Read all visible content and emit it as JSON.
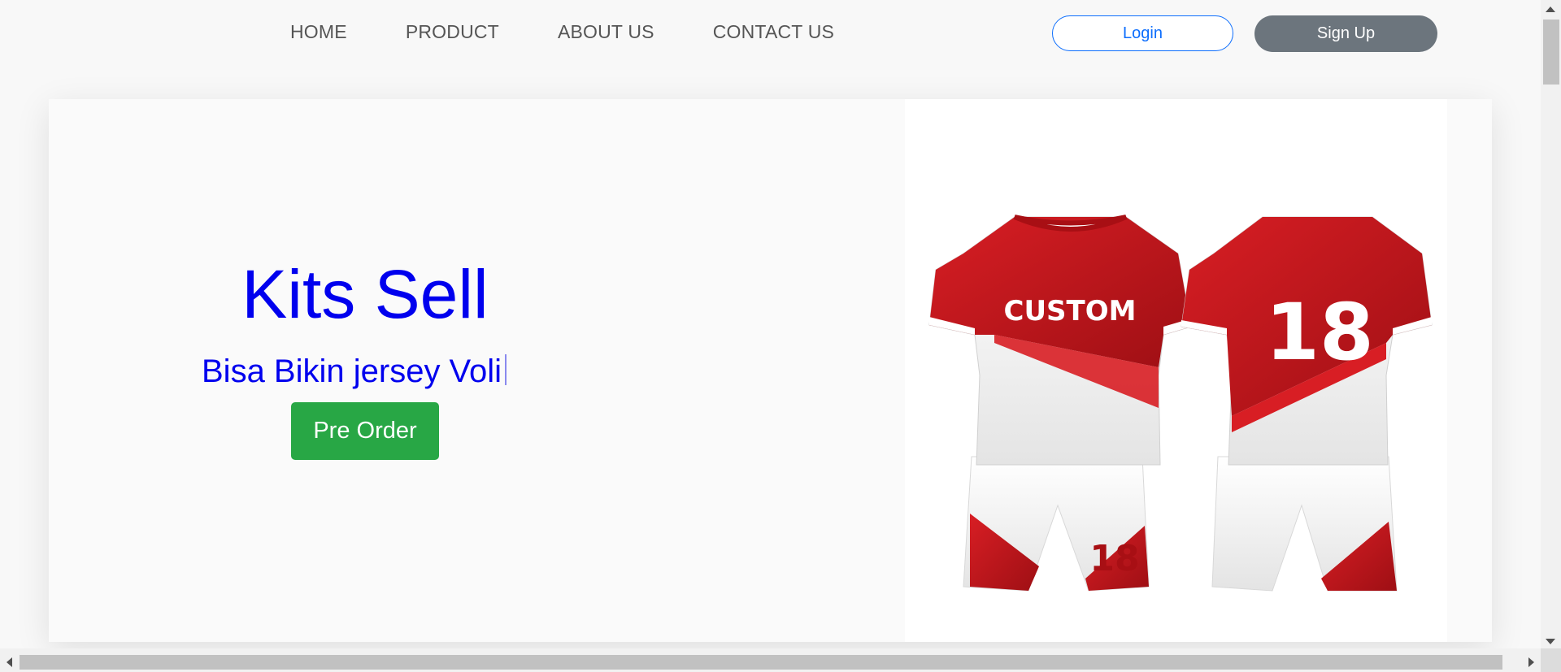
{
  "nav": {
    "links": [
      "HOME",
      "PRODUCT",
      "ABOUT US",
      "CONTACT US"
    ],
    "login_label": "Login",
    "signup_label": "Sign Up"
  },
  "hero": {
    "title": "Kits Sell",
    "subtitle": "Bisa Bikin jersey Voli",
    "cta_label": "Pre Order",
    "image": {
      "front_text": "CUSTOM",
      "back_number": "18",
      "shorts_number": "18"
    }
  },
  "colors": {
    "accent_blue": "#0000ee",
    "login_blue": "#0d6efd",
    "signup_gray": "#6c757d",
    "cta_green": "#28a745",
    "jersey_red": "#c8151b"
  }
}
